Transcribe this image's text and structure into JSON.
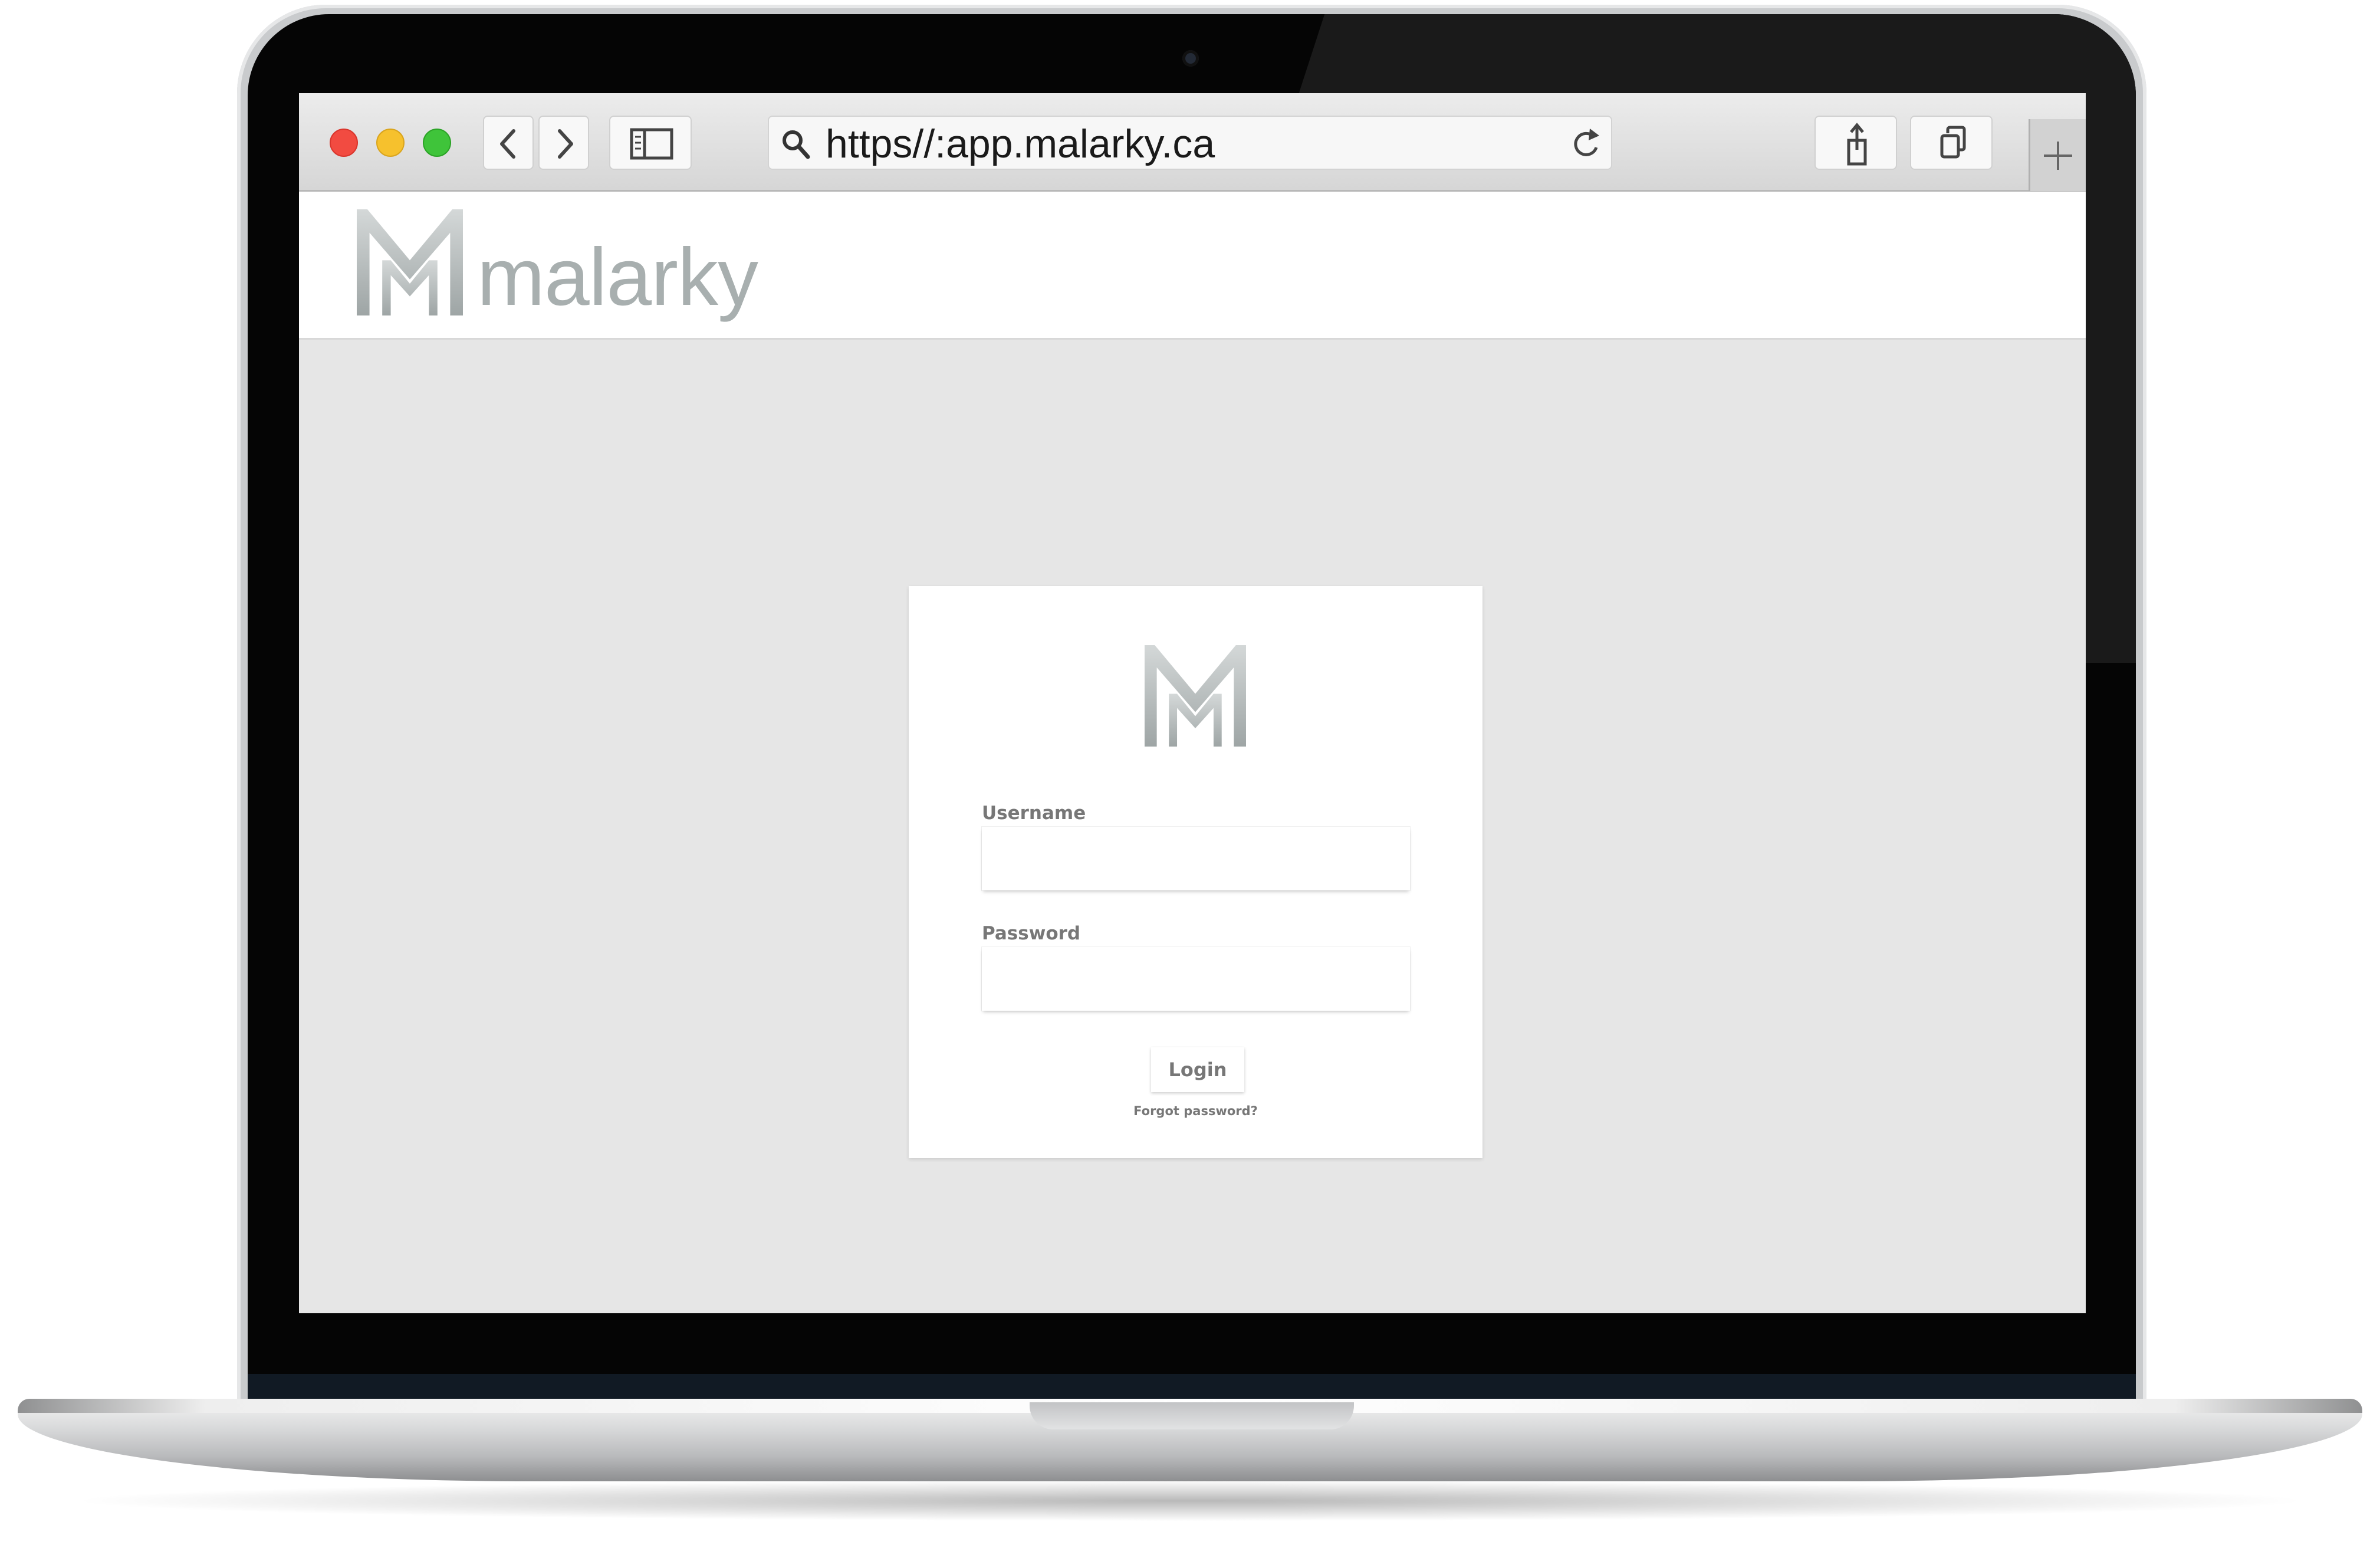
{
  "browser": {
    "url": "https//:app.malarky.ca",
    "traffic_lights": {
      "close": "#f24b41",
      "minimize": "#f6c12d",
      "maximize": "#3fc43a"
    }
  },
  "site": {
    "brand_name": "malarky",
    "brand_color": "#a8afaf"
  },
  "login": {
    "username_label": "Username",
    "username_value": "",
    "password_label": "Password",
    "password_value": "",
    "login_button": "Login",
    "forgot_link": "Forgot password?"
  },
  "icons": {
    "back": "chevron-left-icon",
    "forward": "chevron-right-icon",
    "sidebar": "sidebar-icon",
    "search": "search-icon",
    "reload": "reload-icon",
    "share": "share-icon",
    "tabs": "tabs-icon",
    "new_tab": "plus-icon"
  }
}
